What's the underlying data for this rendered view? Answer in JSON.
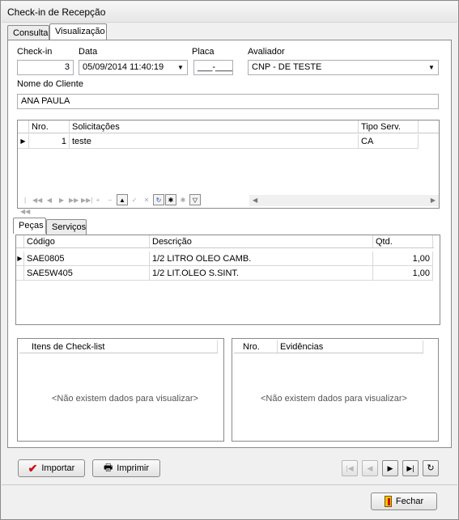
{
  "window": {
    "title": "Check-in de Recepção"
  },
  "tabs": [
    {
      "label": "Consulta",
      "active": false
    },
    {
      "label": "Visualização",
      "active": true
    }
  ],
  "form": {
    "checkin_label": "Check-in",
    "checkin_value": "3",
    "data_label": "Data",
    "data_value": "05/09/2014 11:40:19",
    "placa_label": "Placa",
    "placa_value": "___-____",
    "avaliador_label": "Avaliador",
    "avaliador_value": "CNP - DE TESTE",
    "cliente_label": "Nome do Cliente",
    "cliente_value": "ANA PAULA"
  },
  "solicitacoes": {
    "columns": [
      "Nro.",
      "Solicitações",
      "Tipo Serv."
    ],
    "rows": [
      {
        "nro": "1",
        "solicitacao": "teste",
        "tipo": "CA"
      }
    ]
  },
  "inner_tabs": [
    {
      "label": "Peças",
      "active": true
    },
    {
      "label": "Serviços",
      "active": false
    }
  ],
  "pecas": {
    "columns": [
      "Código",
      "Descrição",
      "Qtd."
    ],
    "rows": [
      {
        "codigo": "SAE0805",
        "descricao": "1/2 LITRO OLEO CAMB.",
        "qtd": "1,00"
      },
      {
        "codigo": "SAE5W405",
        "descricao": "1/2 LIT.OLEO S.SINT.",
        "qtd": "1,00"
      }
    ]
  },
  "checklist": {
    "header": "Itens de Check-list",
    "empty": "<Não existem dados para visualizar>"
  },
  "evidencias": {
    "col_nro": "Nro.",
    "col_evid": "Evidências",
    "empty": "<Não existem dados para visualizar>"
  },
  "buttons": {
    "importar": "Importar",
    "imprimir": "Imprimir",
    "fechar": "Fechar"
  },
  "colors": {
    "accent_red": "#cc1010",
    "nav_blue": "#1b4fa8"
  }
}
